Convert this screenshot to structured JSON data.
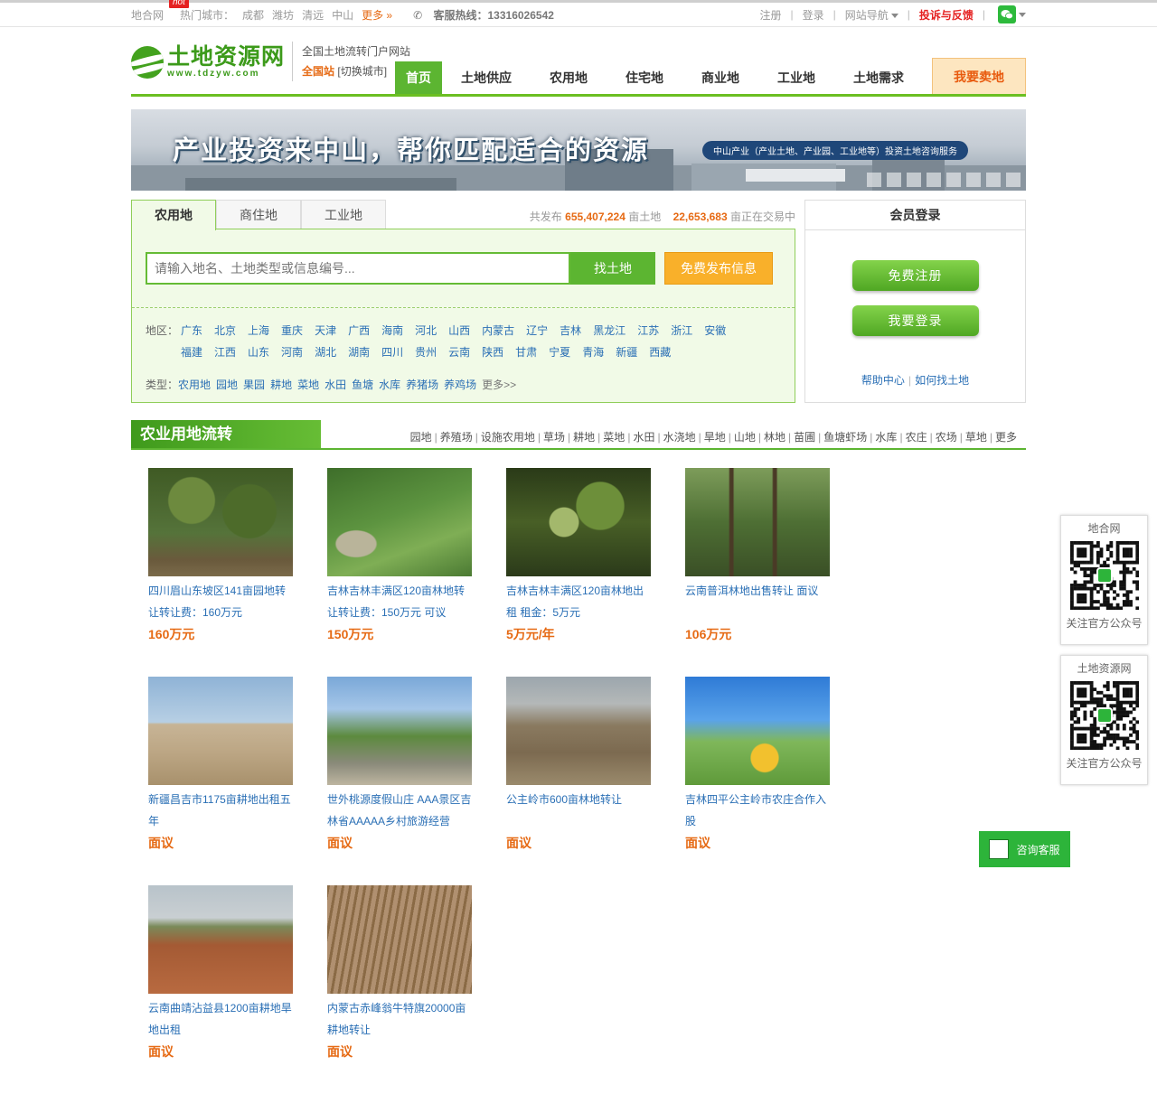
{
  "topbar": {
    "site": "地合网",
    "hot_badge": "hot",
    "hot_cities_label": "热门城市：",
    "cities": [
      "成都",
      "潍坊",
      "清远",
      "中山"
    ],
    "more": "更多 »",
    "phone": "客服热线：13316026542",
    "register": "注册",
    "login": "登录",
    "site_nav": "网站导航",
    "complaint": "投诉与反馈"
  },
  "header": {
    "logo_cn": "土地资源网",
    "logo_en": "www.tdzyw.com",
    "slogan": "全国土地流转门户网站",
    "current_site": "全国站",
    "switch_city": "[切换城市]",
    "nav": [
      "首页",
      "土地供应",
      "农用地",
      "住宅地",
      "商业地",
      "工业地",
      "土地需求"
    ],
    "sell": "我要卖地"
  },
  "banner": {
    "title": "产业投资来中山，帮你匹配适合的资源",
    "tag": "中山产业（产业土地、产业园、工业地等）投资土地咨询服务"
  },
  "search": {
    "tabs": [
      "农用地",
      "商住地",
      "工业地"
    ],
    "stats_prefix": "共发布",
    "stats_total": "655,407,224",
    "stats_mid": "亩土地",
    "stats_trading": "22,653,683",
    "stats_suffix": "亩正在交易中",
    "placeholder": "请输入地名、土地类型或信息编号...",
    "find_button": "找土地",
    "publish_button": "免费发布信息",
    "region_label": "地区：",
    "regions": [
      "广东",
      "北京",
      "上海",
      "重庆",
      "天津",
      "广西",
      "海南",
      "河北",
      "山西",
      "内蒙古",
      "辽宁",
      "吉林",
      "黑龙江",
      "江苏",
      "浙江",
      "安徽",
      "福建",
      "江西",
      "山东",
      "河南",
      "湖北",
      "湖南",
      "四川",
      "贵州",
      "云南",
      "陕西",
      "甘肃",
      "宁夏",
      "青海",
      "新疆",
      "西藏"
    ],
    "type_label": "类型：",
    "types": [
      "农用地",
      "园地",
      "果园",
      "耕地",
      "菜地",
      "水田",
      "鱼塘",
      "水库",
      "养猪场",
      "养鸡场"
    ],
    "types_more": "更多>>"
  },
  "login": {
    "title": "会员登录",
    "register_btn": "免费注册",
    "login_btn": "我要登录",
    "help": "帮助中心",
    "howto": "如何找土地"
  },
  "section": {
    "title": "农业用地流转",
    "links": [
      "园地",
      "养殖场",
      "设施农用地",
      "草场",
      "耕地",
      "菜地",
      "水田",
      "水浇地",
      "旱地",
      "山地",
      "林地",
      "苗圃",
      "鱼塘虾场",
      "水库",
      "农庄",
      "农场",
      "草地",
      "更多"
    ]
  },
  "listings": [
    {
      "title": "四川眉山东坡区141亩园地转让转让费：160万元",
      "price": "160万元",
      "img": "orchard"
    },
    {
      "title": "吉林吉林丰满区120亩林地转让转让费：150万元 可议",
      "price": "150万元",
      "img": "aerial-forest"
    },
    {
      "title": "吉林吉林丰满区120亩林地出租 租金：5万元",
      "price": "5万元/年",
      "img": "leaves"
    },
    {
      "title": "云南普洱林地出售转让 面议",
      "price": "106万元",
      "img": "forest"
    },
    {
      "title": "新疆昌吉市1175亩耕地出租五年",
      "price": "面议",
      "img": "field"
    },
    {
      "title": "世外桃源度假山庄 AAA景区吉林省AAAAA乡村旅游经营",
      "price": "面议",
      "img": "resort"
    },
    {
      "title": "公主岭市600亩林地转让",
      "price": "面议",
      "img": "hills"
    },
    {
      "title": "吉林四平公主岭市农庄合作入股",
      "price": "面议",
      "img": "farm-flags"
    },
    {
      "title": "云南曲靖沾益县1200亩耕地旱地出租",
      "price": "面议",
      "img": "red-soil"
    },
    {
      "title": "内蒙古赤峰翁牛特旗20000亩耕地转让",
      "price": "面议",
      "img": "stubble"
    }
  ],
  "float": {
    "qr1_title": "地合网",
    "qr1_foot": "关注官方公众号",
    "qr2_title": "土地资源网",
    "qr2_foot": "关注官方公众号",
    "consult": "咨询客服"
  }
}
